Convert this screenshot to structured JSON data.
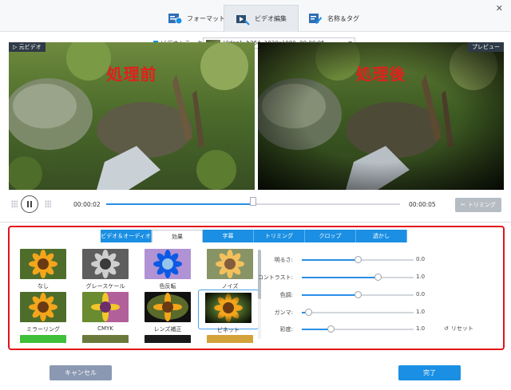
{
  "tabs": [
    {
      "label": "フォーマット",
      "icon": "format-settings-icon",
      "active": false
    },
    {
      "label": "ビデオ編集",
      "icon": "video-edit-icon",
      "active": true
    },
    {
      "label": "名称＆タグ",
      "icon": "edit-tag-icon",
      "active": false
    }
  ],
  "source": {
    "label": "ビデオトラック:",
    "value": "Video1: h264, 1920x1080, 00:00:05"
  },
  "preview": {
    "original_tag": "▷ 元ビデオ",
    "preview_tag": "プレビュー",
    "before_caption": "処理前",
    "after_caption": "処理後"
  },
  "playback": {
    "current_time": "00:00:02",
    "total_time": "00:00:05",
    "progress": 0.5,
    "trim_label": "トリミング"
  },
  "edit_tabs": [
    {
      "label": "ビデオ＆オーディオ",
      "active": false
    },
    {
      "label": "効果",
      "active": true
    },
    {
      "label": "字幕",
      "active": false
    },
    {
      "label": "トリミング",
      "active": false
    },
    {
      "label": "クロップ",
      "active": false
    },
    {
      "label": "透かし",
      "active": false
    }
  ],
  "effects": [
    {
      "label": "なし",
      "style": "normal"
    },
    {
      "label": "グレースケール",
      "style": "gray"
    },
    {
      "label": "色反転",
      "style": "invert"
    },
    {
      "label": "ノイズ",
      "style": "noise"
    },
    {
      "label": "ミラーリング",
      "style": "mirror"
    },
    {
      "label": "CMYK",
      "style": "cmyk"
    },
    {
      "label": "レンズ補正",
      "style": "lens"
    },
    {
      "label": "ビネット",
      "style": "vignette"
    }
  ],
  "adjustments": [
    {
      "label": "明るさ:",
      "value": "0.0",
      "fraction": 0.5
    },
    {
      "label": "コントラスト:",
      "value": "1.0",
      "fraction": 0.68
    },
    {
      "label": "色調:",
      "value": "0.0",
      "fraction": 0.5
    },
    {
      "label": "ガンマ:",
      "value": "1.0",
      "fraction": 0.06
    },
    {
      "label": "彩度:",
      "value": "1.0",
      "fraction": 0.26
    }
  ],
  "reset_label": "リセット",
  "footer": {
    "cancel_label": "キャンセル",
    "ok_label": "完了"
  },
  "colors": {
    "accent": "#1a8fe3",
    "caption": "#e0201b",
    "highlight_border": "#e3141b"
  }
}
